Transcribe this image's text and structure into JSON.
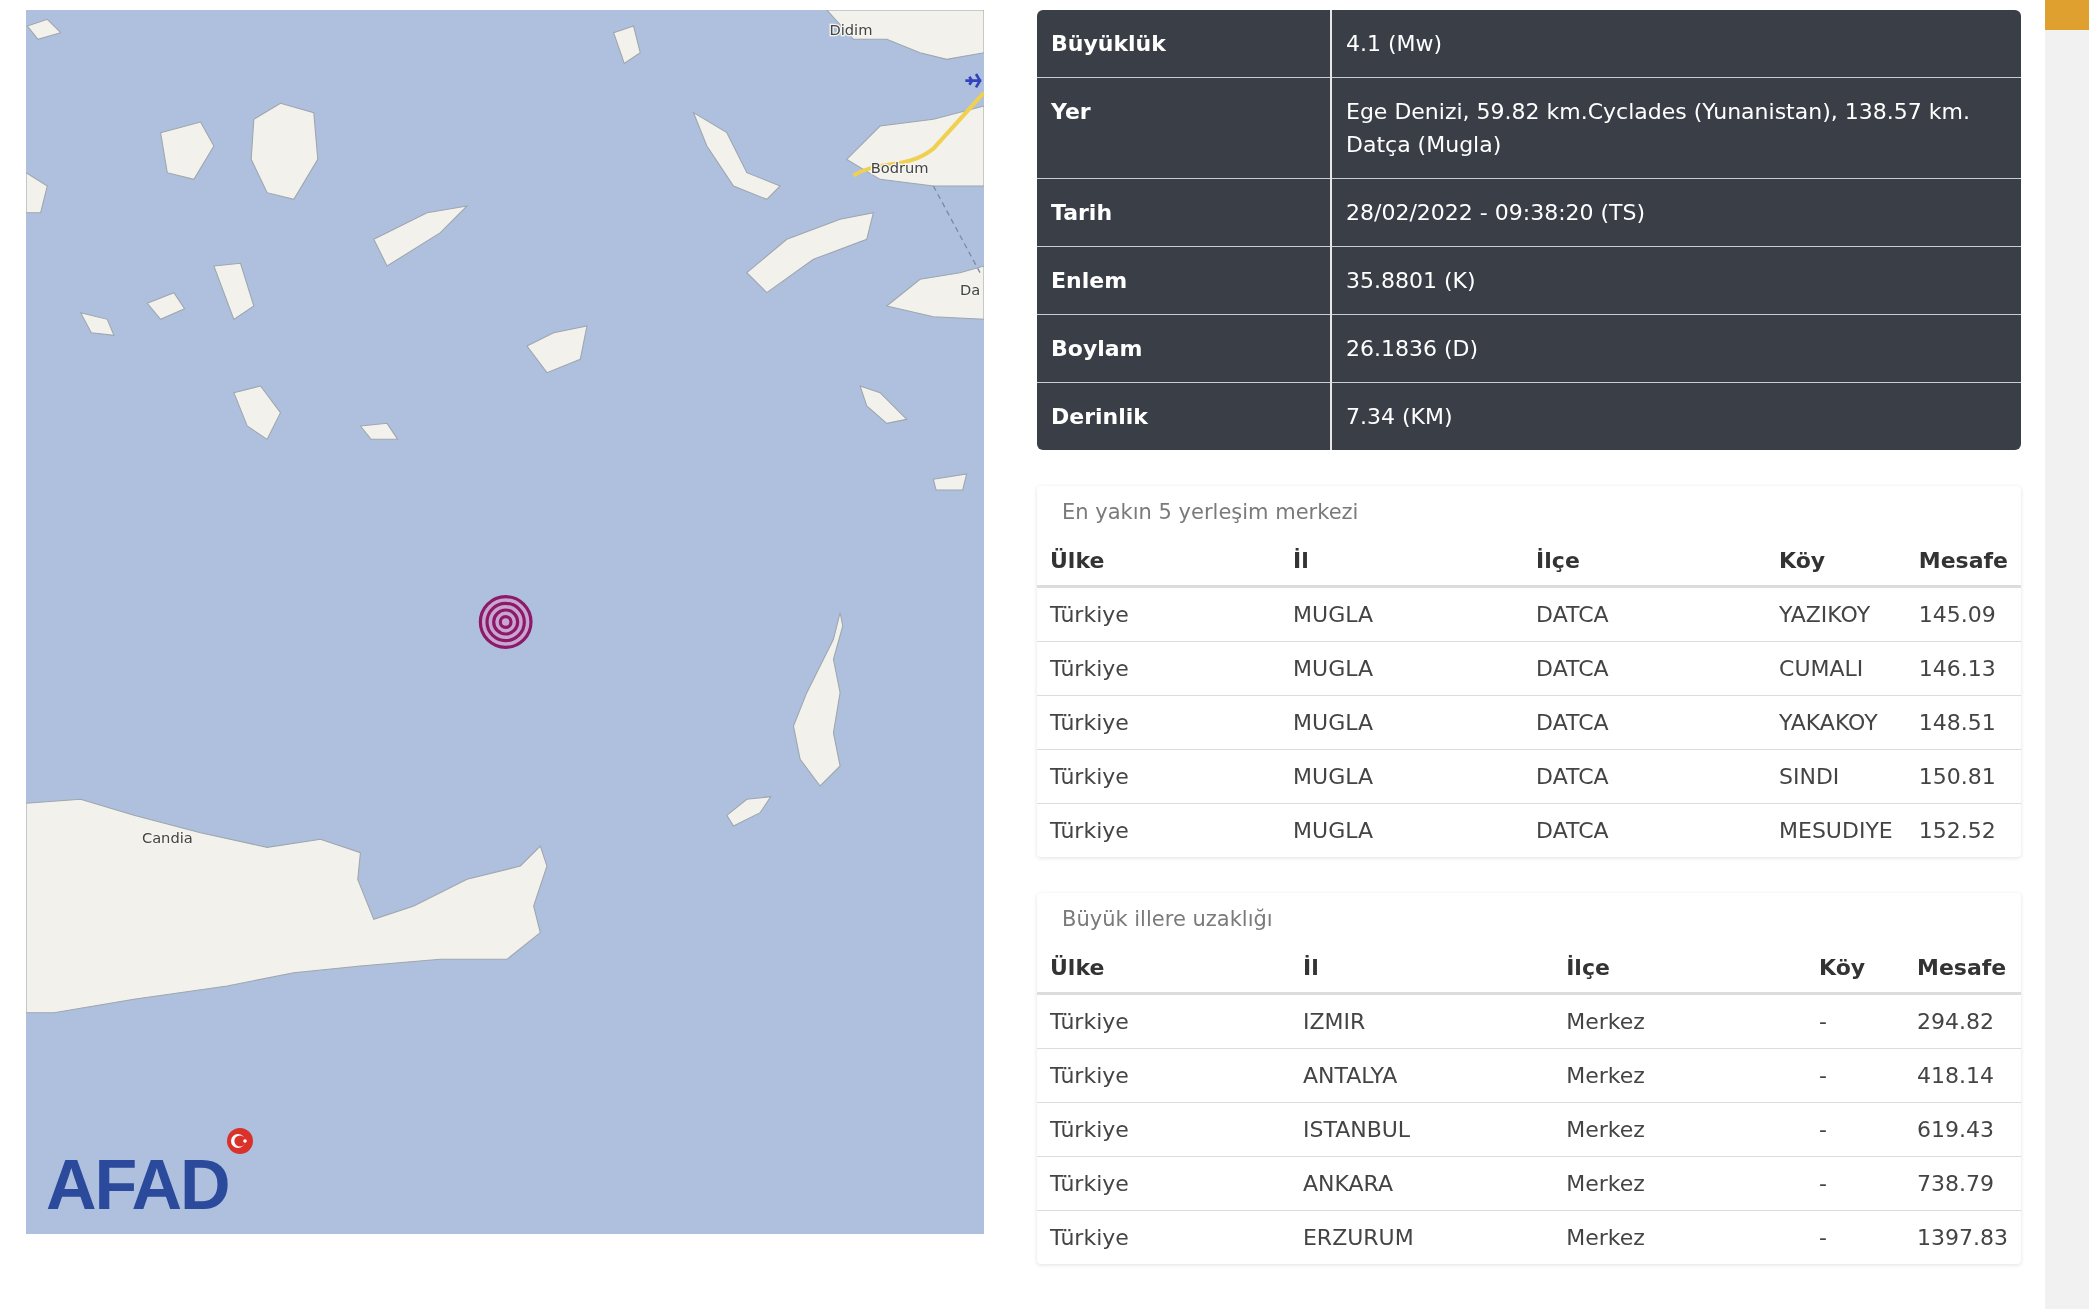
{
  "map": {
    "labels": [
      "Didim",
      "Bodrum",
      "Da",
      "Candia"
    ],
    "logo": {
      "text": "AFAD"
    }
  },
  "details": [
    {
      "label": "Büyüklük",
      "value": "4.1 (Mw)"
    },
    {
      "label": "Yer",
      "value": "Ege Denizi, 59.82 km.Cyclades (Yunanistan), 138.57 km. Datça (Mugla)"
    },
    {
      "label": "Tarih",
      "value": "28/02/2022 - 09:38:20 (TS)"
    },
    {
      "label": "Enlem",
      "value": "35.8801 (K)"
    },
    {
      "label": "Boylam",
      "value": "26.1836 (D)"
    },
    {
      "label": "Derinlik",
      "value": "7.34 (KM)"
    }
  ],
  "sections": [
    {
      "title": "En yakın 5 yerleşim merkezi",
      "columns": [
        "Ülke",
        "İl",
        "İlçe",
        "Köy",
        "Mesafe"
      ],
      "rows": [
        [
          "Türkiye",
          "MUGLA",
          "DATCA",
          "YAZIKOY",
          "145.09"
        ],
        [
          "Türkiye",
          "MUGLA",
          "DATCA",
          "CUMALI",
          "146.13"
        ],
        [
          "Türkiye",
          "MUGLA",
          "DATCA",
          "YAKAKOY",
          "148.51"
        ],
        [
          "Türkiye",
          "MUGLA",
          "DATCA",
          "SINDI",
          "150.81"
        ],
        [
          "Türkiye",
          "MUGLA",
          "DATCA",
          "MESUDIYE",
          "152.52"
        ]
      ]
    },
    {
      "title": "Büyük illere uzaklığı",
      "columns": [
        "Ülke",
        "İl",
        "İlçe",
        "Köy",
        "Mesafe"
      ],
      "rows": [
        [
          "Türkiye",
          "IZMIR",
          "Merkez",
          "-",
          "294.82"
        ],
        [
          "Türkiye",
          "ANTALYA",
          "Merkez",
          "-",
          "418.14"
        ],
        [
          "Türkiye",
          "ISTANBUL",
          "Merkez",
          "-",
          "619.43"
        ],
        [
          "Türkiye",
          "ANKARA",
          "Merkez",
          "-",
          "738.79"
        ],
        [
          "Türkiye",
          "ERZURUM",
          "Merkez",
          "-",
          "1397.83"
        ]
      ]
    }
  ]
}
